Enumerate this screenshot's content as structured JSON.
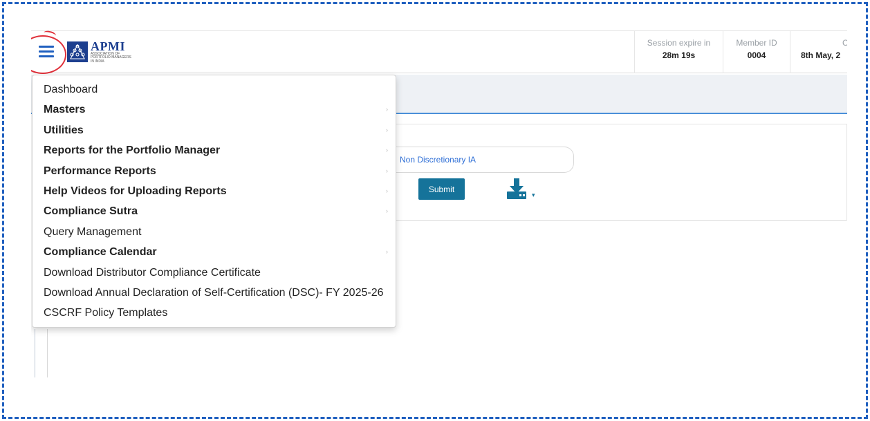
{
  "header": {
    "logo": {
      "name": "APMI",
      "sub1": "ASSOCIATION OF",
      "sub2": "PORTFOLIO MANAGERS",
      "sub3": "IN INDIA"
    },
    "session": {
      "label": "Session expire in",
      "value": "28m 19s"
    },
    "member": {
      "label": "Member ID",
      "value": "0004"
    },
    "current": {
      "label": "Cur",
      "value": "8th May, 2"
    }
  },
  "menu": {
    "items": [
      {
        "label": "Dashboard"
      },
      {
        "label": "Masters"
      },
      {
        "label": "Utilities"
      },
      {
        "label": "Reports for the Portfolio Manager"
      },
      {
        "label": "Performance Reports"
      },
      {
        "label": "Help Videos for Uploading Reports"
      },
      {
        "label": "Compliance Sutra"
      },
      {
        "label": "Query Management"
      },
      {
        "label": "Compliance Calendar"
      },
      {
        "label": "Download Distributor Compliance Certificate"
      },
      {
        "label": "Download Annual Declaration of Self-Certification (DSC)- FY 2025-26"
      },
      {
        "label": "CSCRF Policy Templates"
      }
    ],
    "submenu_arrow": "›"
  },
  "content": {
    "option_label": "Non Discretionary IA",
    "submit_label": "Submit",
    "download_caret": "▾"
  },
  "colors": {
    "accent": "#1f5fbf",
    "submit": "#15739a",
    "highlight": "#e0303a",
    "brand": "#1d3f8f"
  }
}
